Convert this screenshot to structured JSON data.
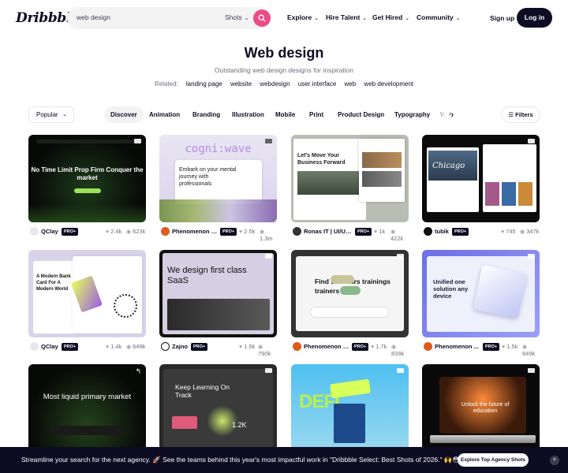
{
  "header": {
    "logo": "Dribbble",
    "search_value": "web design",
    "search_scope": "Shots",
    "nav": [
      "Explore",
      "Hire Talent",
      "Get Hired",
      "Community"
    ],
    "signup": "Sign up",
    "login": "Log in"
  },
  "title": "Web design",
  "subtitle": "Outstanding web design designs for inspiration",
  "related": {
    "label": "Related:",
    "tags": [
      "landing page",
      "website",
      "webdesign",
      "user interface",
      "web",
      "web development"
    ]
  },
  "filters": {
    "sort": "Popular",
    "categories": [
      "Discover",
      "Animation",
      "Branding",
      "Illustration",
      "Mobile",
      "Print",
      "Product Design",
      "Typography",
      "Web"
    ],
    "active_category": "Discover",
    "filters_label": "Filters"
  },
  "shots": [
    {
      "author": "QClay",
      "badge": "PRO+",
      "likes": "2.4k",
      "views": "623k",
      "headline": "No Time Limit Prop Firm Conquer the market"
    },
    {
      "author": "Phenomenon S...",
      "badge": "PRO+",
      "likes": "2.5k",
      "views": "1.3m",
      "headline": "cogni:wave",
      "sub": "Embark on your mental journey with professionals"
    },
    {
      "author": "Ronas IT | UI/UX...",
      "badge": "PRO+",
      "likes": "1k",
      "views": "422k",
      "headline": "Let's Move Your Business Forward"
    },
    {
      "author": "tubik",
      "badge": "PRO+",
      "likes": "745",
      "views": "347k",
      "headline": "Chicago"
    },
    {
      "author": "QClay",
      "badge": "PRO+",
      "likes": "1.4k",
      "views": "649k",
      "headline": "A Modern Bank Card For A Modern World"
    },
    {
      "author": "Zajno",
      "badge": "PRO+",
      "likes": "1.5k",
      "views": "790k",
      "headline": "We design first class SaaS"
    },
    {
      "author": "Phenomenon S...",
      "badge": "PRO+",
      "likes": "1.7k",
      "views": "839k",
      "headline": "Find seminars trainings trainers"
    },
    {
      "author": "Phenomenon ...",
      "badge": "PRO+",
      "likes": "1.5k",
      "views": "849k",
      "headline": "Unified one solution any device"
    },
    {
      "headline": "Most liquid primary market"
    },
    {
      "headline": "Keep Learning On Track",
      "value": "1.2K"
    },
    {
      "headline": "DEFI"
    },
    {
      "headline": "Unlock the future of education"
    }
  ],
  "banner": {
    "text": "Streamline your search for the next agency. 🚀 See the teams behind this year's most impactful work in \"Dribbble Select: Best Shots of 2026.\" 🙌😳",
    "button": "Explore Top Agency Shots"
  },
  "colors": {
    "brand_pink": "#ea4c89",
    "dark": "#0d0c22",
    "muted": "#6e6d7a"
  }
}
